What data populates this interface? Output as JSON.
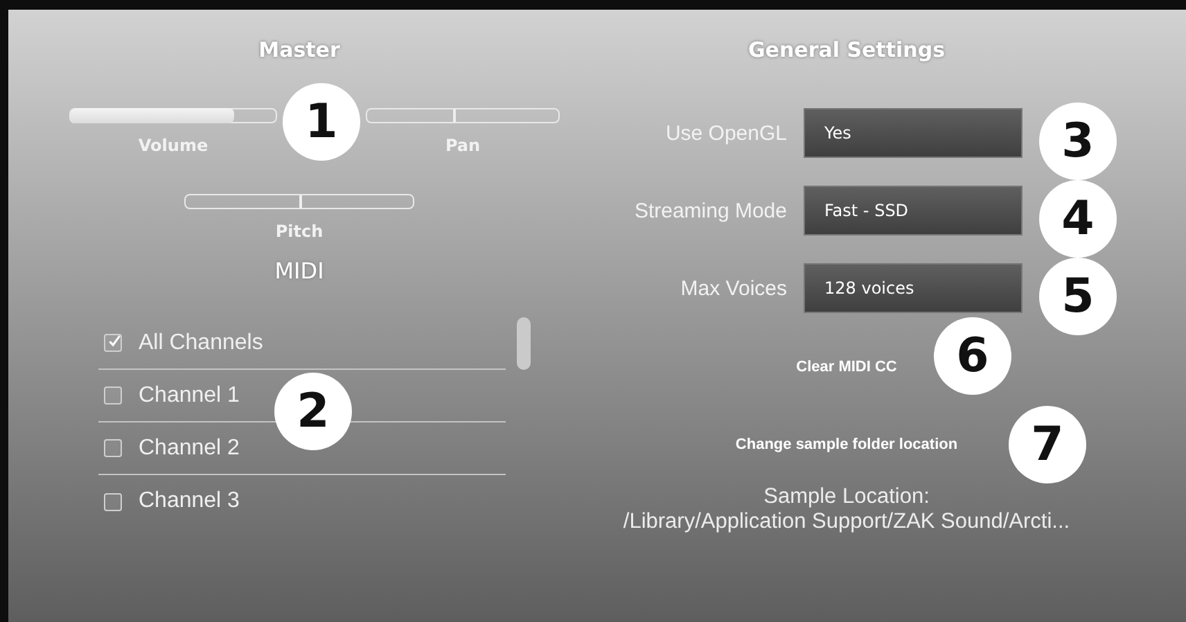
{
  "master": {
    "title": "Master",
    "sliders": [
      {
        "label": "Volume",
        "kind": "fill",
        "level": 0.8
      },
      {
        "label": "Pan",
        "kind": "center",
        "level": 0.45
      },
      {
        "label": "Pitch",
        "kind": "center",
        "level": 0.5
      }
    ]
  },
  "midi": {
    "title": "MIDI",
    "channels": [
      {
        "label": "All Channels",
        "checked": true
      },
      {
        "label": "Channel 1",
        "checked": false
      },
      {
        "label": "Channel 2",
        "checked": false
      },
      {
        "label": "Channel 3",
        "checked": false
      }
    ]
  },
  "general_settings": {
    "title": "General Settings",
    "dropdowns": [
      {
        "label": "Use OpenGL",
        "value": "Yes"
      },
      {
        "label": "Streaming Mode",
        "value": "Fast - SSD"
      },
      {
        "label": "Max Voices",
        "value": "128 voices"
      }
    ],
    "buttons": [
      "Clear MIDI CC",
      "Change sample folder location"
    ],
    "sample_location": {
      "label": "Sample Location:",
      "path": "/Library/Application Support/ZAK Sound/Arcti..."
    }
  },
  "callouts": [
    "1",
    "2",
    "3",
    "4",
    "5",
    "6",
    "7"
  ]
}
